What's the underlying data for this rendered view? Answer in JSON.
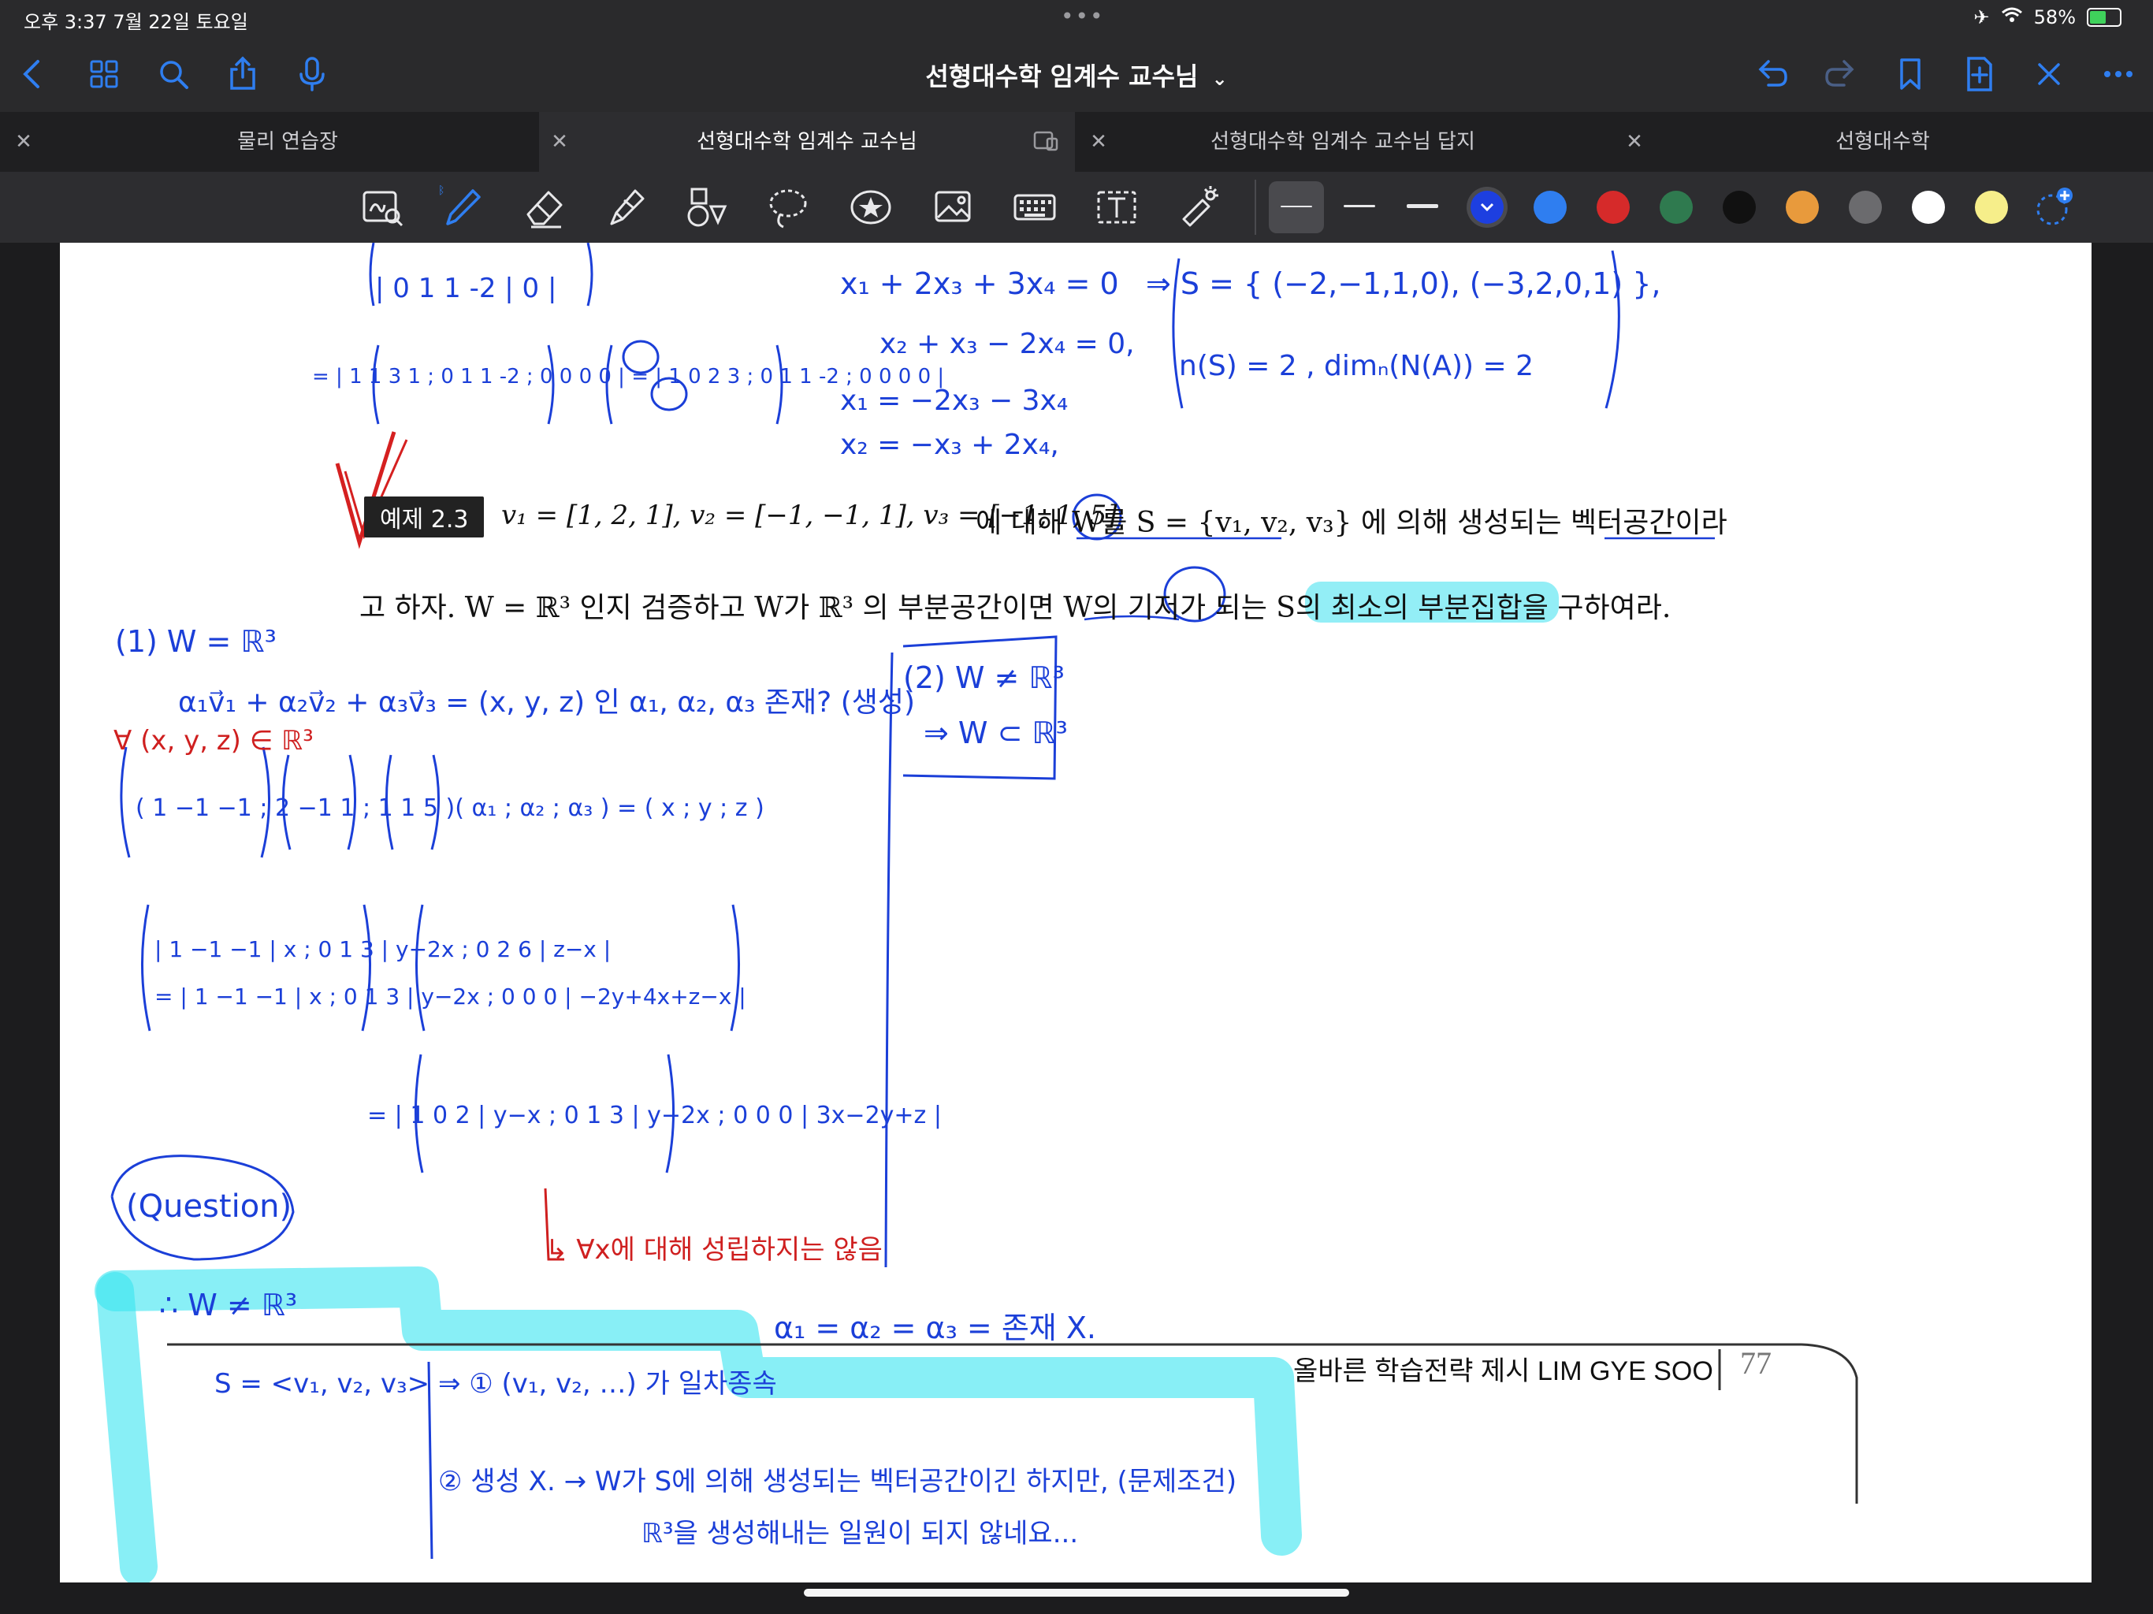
{
  "status_bar": {
    "time_date": "오후 3:37   7월 22일 토요일",
    "dots": "•••",
    "battery_pct": "58%"
  },
  "nav": {
    "title": "선형대수학 임계수 교수님",
    "title_chevron": "⌄"
  },
  "tabs": [
    {
      "label": "물리 연습장",
      "active": false
    },
    {
      "label": "선형대수학 임계수 교수님",
      "active": true
    },
    {
      "label": "선형대수학 임계수 교수님 답지",
      "active": false
    },
    {
      "label": "선형대수학",
      "active": false
    }
  ],
  "toolbar": {
    "colors": [
      "#1d3fe0",
      "#2f7ef0",
      "#d62a2a",
      "#2f7a4f",
      "#111111",
      "#e89a3c",
      "#6b6b6e",
      "#ffffff",
      "#f6ee8a"
    ],
    "selected_color": "#1d3fe0"
  },
  "document": {
    "badge": "예제 2.3",
    "problem_line1_vectors": "v₁ = [1, 2, 1],  v₂ = [−1, −1, 1],  v₃ = [−1, 1, 5]",
    "problem_line1_tail": "에 대해 W를 S = {v₁, v₂, v₃} 에 의해 생성되는 벡터공간이라",
    "problem_line2": "고 하자. W = ℝ³ 인지 검증하고 W가 ℝ³ 의 부분공간이면 W의 기저가 되는 S의 최소의 부분집합을 구하여라.",
    "footer": "올바른 학습전략 제시 LIM GYE SOO",
    "page_number": "77"
  },
  "handwriting": {
    "top_matrix_row": "| 0  1  1  -2 | 0 |",
    "eq_matrix_1": "= | 1 1 3 1 ; 0 1 1 -2 ; 0 0 0 0 | = | 1 0 2 3 ; 0 1 1 -2 ; 0 0 0 0 |",
    "top_mid_1": "x₁ + 2x₃ + 3x₄ = 0",
    "top_mid_2": "x₂ + x₃ − 2x₄ = 0,",
    "top_mid_3": "x₁ = −2x₃ − 3x₄",
    "top_mid_4": "x₂ = −x₃ + 2x₄,",
    "top_right_1": "⇒ S = { (−2,−1,1,0), (−3,2,0,1) },",
    "top_right_2": "n(S) = 2   , dimₙ(N(A)) = 2",
    "item1_head": "(1) W = ℝ³",
    "item1_line": "α₁v⃗₁ + α₂v⃗₂ + α₃v⃗₃ = (x, y, z) 인  α₁, α₂, α₃ 존재? (생성)",
    "red_note_1": "∀ (x, y, z) ∈ ℝ³",
    "matrix_eq": "( 1 −1 −1 ; 2 −1 1 ; 1 1 5 )( α₁ ; α₂ ; α₃ ) = ( x ; y ; z )",
    "aug1": "| 1 −1 −1 | x ; 0 1 3 | y−2x ; 0 2 6 | z−x |",
    "aug2": "= | 1 −1 −1 | x ; 0 1 3 | y−2x ; 0 0 0 | −2y+4x+z−x |",
    "aug3": "= | 1 0 2 | y−x ; 0 1 3 | y−2x ; 0 0 0 | 3x−2y+z |",
    "red_note_2": "↳ ∀x에 대해 성립하지는 않음",
    "item2_1": "(2)  W ≠ ℝ³",
    "item2_2": "⇒ W ⊂ ℝ³",
    "question": "(Question)",
    "q_line1": "∴ W ≠ ℝ³",
    "q_alpha": "α₁ =    α₂ =    α₃ = 존재 X.",
    "q_line2": "S = <v₁, v₂, v₃> ⇒ ① (v₁, v₂, …) 가 일차종속",
    "q_line3": "② 생성 X.  → W가 S에 의해 생성되는 벡터공간이긴 하지만, (문제조건)",
    "q_line4": "ℝ³을 생성해내는 일원이 되지 않네요..."
  }
}
